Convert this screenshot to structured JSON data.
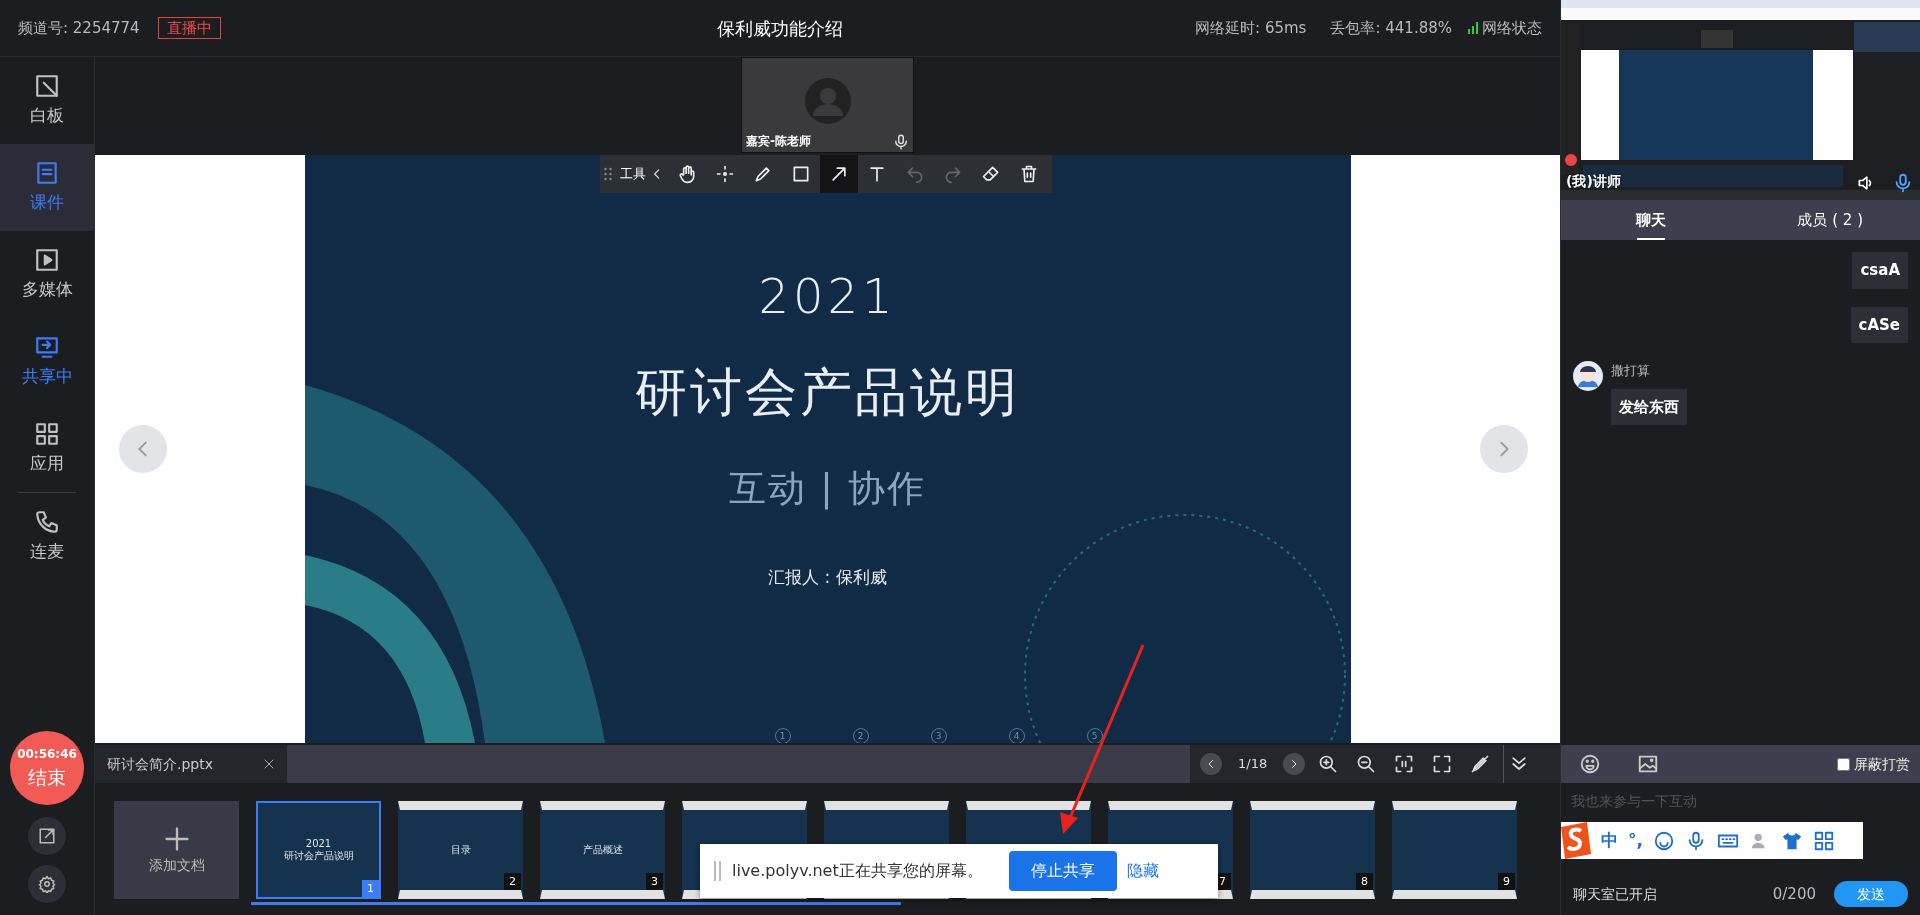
{
  "top_bar": {
    "channel": "频道号: 2254774",
    "live_badge": "直播中",
    "title": "保利威功能介绍",
    "latency": "网络延时: 65ms",
    "packet_loss": "丢包率: 441.88%",
    "network_status": "网络状态"
  },
  "sidebar": {
    "groups": [
      [
        {
          "kind": "whiteboard",
          "label": "白板",
          "selected": false,
          "active": false
        },
        {
          "kind": "courseware",
          "label": "课件",
          "selected": true,
          "active": true
        },
        {
          "kind": "media",
          "label": "多媒体",
          "selected": false,
          "active": false
        },
        {
          "kind": "share",
          "label": "共享中",
          "selected": false,
          "active": true
        },
        {
          "kind": "apps",
          "label": "应用",
          "selected": false,
          "active": false
        }
      ],
      [
        {
          "kind": "call",
          "label": "连麦",
          "selected": false,
          "active": false
        }
      ]
    ],
    "timer": "00:56:46",
    "end_label": "结束"
  },
  "video_tile": {
    "name": "嘉宾-陈老师"
  },
  "tool_bar": {
    "label": "工具",
    "tools": [
      {
        "kind": "hand",
        "selected": false,
        "disabled": false
      },
      {
        "kind": "move",
        "selected": false,
        "disabled": false
      },
      {
        "kind": "pen",
        "selected": false,
        "disabled": false
      },
      {
        "kind": "rect",
        "selected": false,
        "disabled": false
      },
      {
        "kind": "arrow",
        "selected": true,
        "disabled": false
      },
      {
        "kind": "text",
        "selected": false,
        "disabled": false
      },
      {
        "kind": "undo",
        "selected": false,
        "disabled": true
      },
      {
        "kind": "redo",
        "selected": false,
        "disabled": true
      },
      {
        "kind": "eraser",
        "selected": false,
        "disabled": false
      },
      {
        "kind": "delete",
        "selected": false,
        "disabled": false
      }
    ]
  },
  "slide": {
    "year": "2021",
    "title": "研讨会产品说明",
    "subtitle": "互动 | 协作",
    "presenter": "汇报人 : 保利威",
    "page_marks": [
      "1",
      "2",
      "3",
      "4",
      "5"
    ]
  },
  "doc_bar": {
    "file_tab": "研讨会简介.pptx",
    "page": "1/18"
  },
  "thumbnails": {
    "add_label": "添加文档",
    "items": [
      {
        "number": "1",
        "selected": true,
        "lines": [
          "2021",
          "研讨会产品说明"
        ]
      },
      {
        "number": "2",
        "selected": false,
        "lines": [
          "目录"
        ]
      },
      {
        "number": "3",
        "selected": false,
        "lines": [
          "产品概述"
        ]
      },
      {
        "selected": false
      },
      {
        "selected": false
      },
      {
        "selected": false
      },
      {
        "number": "7",
        "selected": false
      },
      {
        "number": "8",
        "selected": false
      },
      {
        "number": "9",
        "selected": false
      }
    ]
  },
  "share_notice": {
    "message": "live.polyv.net正在共享您的屏幕。",
    "stop_button": "停止共享",
    "hide_link": "隐藏"
  },
  "right_panel": {
    "preview": {
      "label": "(我)讲师"
    },
    "tabs": [
      {
        "label": "聊天",
        "selected": true
      },
      {
        "label": "成员 ( 2 )",
        "selected": false
      }
    ],
    "messages": [
      {
        "kind": "own",
        "text": "csaA"
      },
      {
        "kind": "own",
        "text": "cASe"
      },
      {
        "kind": "other",
        "sender": "撒打算",
        "text": "发给东西"
      }
    ],
    "block_rewards": {
      "label": "屏蔽打赏",
      "checked": false
    },
    "input": {
      "placeholder": "我也来参与一下互动"
    },
    "ime": {
      "mode": "中",
      "punctuation": "°,"
    },
    "status": "聊天室已开启",
    "counter": "0/200",
    "send": "发送"
  }
}
